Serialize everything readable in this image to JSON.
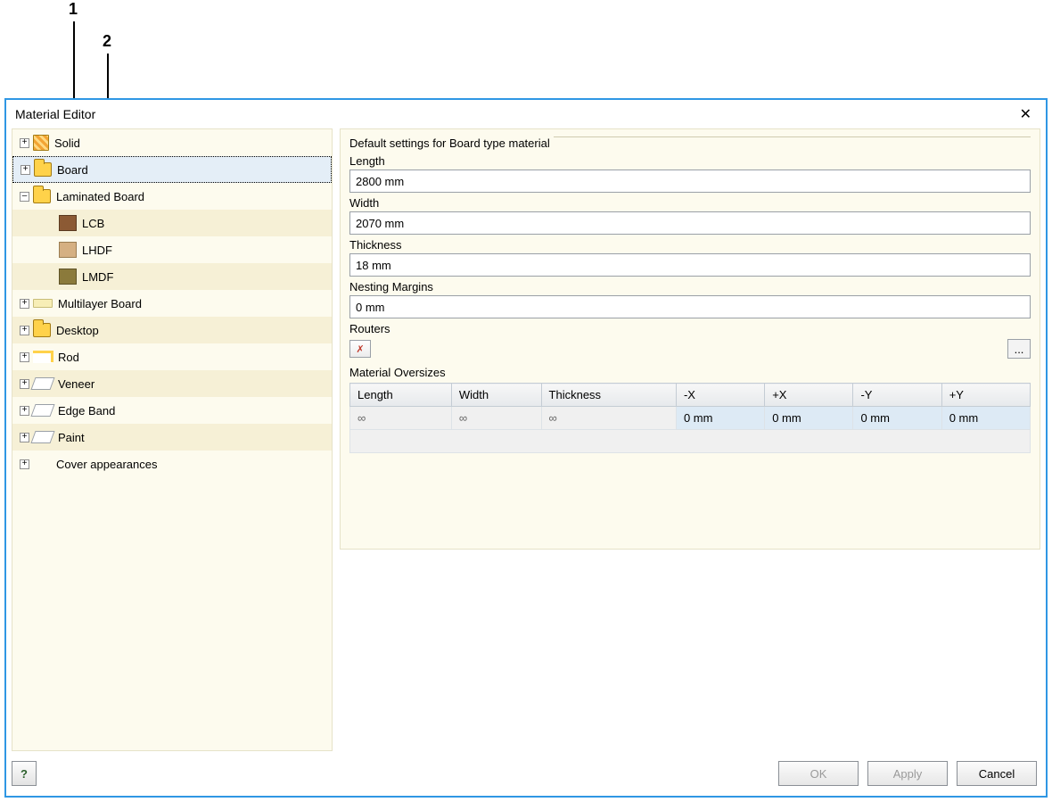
{
  "callouts": {
    "one": "1",
    "two": "2"
  },
  "window": {
    "title": "Material Editor"
  },
  "tree": {
    "items": {
      "solid": "Solid",
      "board": "Board",
      "lamboard": "Laminated Board",
      "lcb": "LCB",
      "lhdf": "LHDF",
      "lmdf": "LMDF",
      "multilayer": "Multilayer Board",
      "desktop": "Desktop",
      "rod": "Rod",
      "veneer": "Veneer",
      "edgeband": "Edge Band",
      "paint": "Paint",
      "cover": "Cover appearances"
    }
  },
  "settings": {
    "title": "Default settings for Board type material",
    "fields": {
      "length_label": "Length",
      "length_value": "2800 mm",
      "width_label": "Width",
      "width_value": "2070 mm",
      "thickness_label": "Thickness",
      "thickness_value": "18 mm",
      "nesting_label": "Nesting Margins",
      "nesting_value": "0 mm",
      "routers_label": "Routers"
    },
    "oversizes": {
      "title": "Material Oversizes",
      "headers": {
        "length": "Length",
        "width": "Width",
        "thickness": "Thickness",
        "nx": "-X",
        "px": "+X",
        "ny": "-Y",
        "py": "+Y"
      },
      "row": {
        "length": "∞",
        "width": "∞",
        "thickness": "∞",
        "nx": "0 mm",
        "px": "0 mm",
        "ny": "0 mm",
        "py": "0 mm"
      }
    }
  },
  "buttons": {
    "help": "?",
    "ok": "OK",
    "apply": "Apply",
    "cancel": "Cancel",
    "more": "..."
  }
}
